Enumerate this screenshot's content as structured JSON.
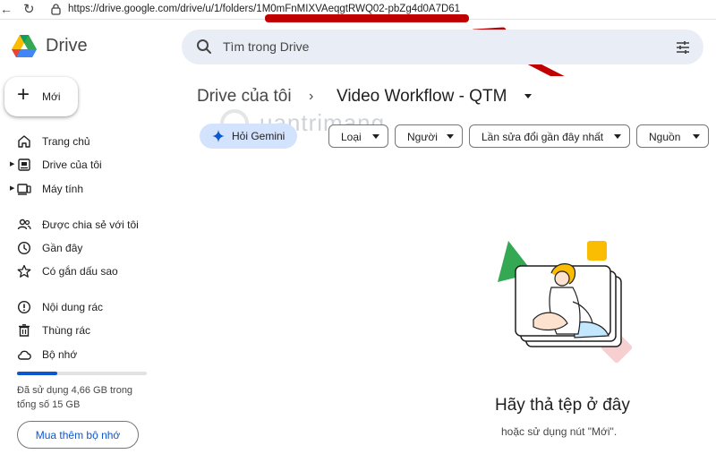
{
  "browser": {
    "url": "https://drive.google.com/drive/u/1/folders/1M0mFnMIXVAeqgtRWQ02-pbZg4d0A7D61"
  },
  "app": {
    "name": "Drive"
  },
  "search": {
    "placeholder": "Tìm trong Drive"
  },
  "new_button": {
    "label": "Mới"
  },
  "sidebar": {
    "items": [
      {
        "label": "Trang chủ",
        "icon": "home-icon"
      },
      {
        "label": "Drive của tôi",
        "icon": "my-drive-icon"
      },
      {
        "label": "Máy tính",
        "icon": "computer-icon"
      },
      {
        "label": "Được chia sẻ với tôi",
        "icon": "shared-icon"
      },
      {
        "label": "Gần đây",
        "icon": "clock-icon"
      },
      {
        "label": "Có gắn dấu sao",
        "icon": "star-icon"
      },
      {
        "label": "Nội dung rác",
        "icon": "spam-icon"
      },
      {
        "label": "Thùng rác",
        "icon": "trash-icon"
      },
      {
        "label": "Bộ nhớ",
        "icon": "cloud-icon"
      }
    ]
  },
  "storage": {
    "used_fraction": 0.31,
    "text": "Đã sử dụng 4,66 GB trong tổng số 15 GB",
    "buy_label": "Mua thêm bộ nhớ"
  },
  "breadcrumb": {
    "root": "Drive của tôi",
    "separator": "›",
    "current": "Video Workflow - QTM"
  },
  "filters": {
    "gemini": "Hỏi Gemini",
    "chips": [
      "Loại",
      "Người",
      "Lần sửa đổi gần đây nhất",
      "Nguồn"
    ]
  },
  "empty_state": {
    "title": "Hãy thả tệp ở đây",
    "subtitle": "hoặc sử dụng nút \"Mới\"."
  },
  "watermark": {
    "text": "uantrimang"
  },
  "colors": {
    "accent": "#0b57d0",
    "annotation": "#c00000",
    "search_bg": "#e9eef6",
    "gemini_bg": "#d3e3fd"
  }
}
